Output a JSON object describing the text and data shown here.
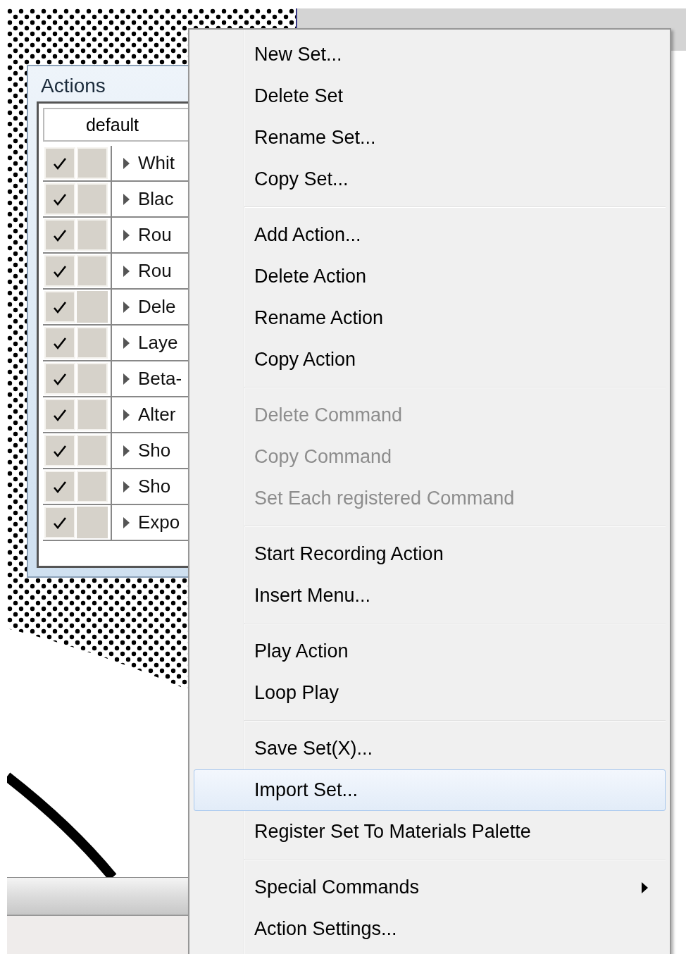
{
  "actions_panel": {
    "title": "Actions",
    "set_name": "default",
    "rows": [
      {
        "name": "Whit",
        "checked": true,
        "dialog_toggle": true
      },
      {
        "name": "Blac",
        "checked": true,
        "dialog_toggle": true
      },
      {
        "name": "Rou",
        "checked": true,
        "dialog_toggle": true
      },
      {
        "name": "Rou",
        "checked": true,
        "dialog_toggle": true
      },
      {
        "name": "Dele",
        "checked": true,
        "dialog_toggle": false
      },
      {
        "name": "Laye",
        "checked": true,
        "dialog_toggle": true
      },
      {
        "name": "Beta-",
        "checked": true,
        "dialog_toggle": true
      },
      {
        "name": "Alter",
        "checked": true,
        "dialog_toggle": true
      },
      {
        "name": "Sho",
        "checked": true,
        "dialog_toggle": true
      },
      {
        "name": "Sho",
        "checked": true,
        "dialog_toggle": true
      },
      {
        "name": "Expo",
        "checked": true,
        "dialog_toggle": false
      }
    ]
  },
  "context_menu": {
    "groups": [
      [
        {
          "label": "New Set...",
          "disabled": false,
          "selected": false,
          "submenu": false
        },
        {
          "label": "Delete Set",
          "disabled": false,
          "selected": false,
          "submenu": false
        },
        {
          "label": "Rename Set...",
          "disabled": false,
          "selected": false,
          "submenu": false
        },
        {
          "label": "Copy Set...",
          "disabled": false,
          "selected": false,
          "submenu": false
        }
      ],
      [
        {
          "label": "Add Action...",
          "disabled": false,
          "selected": false,
          "submenu": false
        },
        {
          "label": "Delete Action",
          "disabled": false,
          "selected": false,
          "submenu": false
        },
        {
          "label": "Rename Action",
          "disabled": false,
          "selected": false,
          "submenu": false
        },
        {
          "label": "Copy Action",
          "disabled": false,
          "selected": false,
          "submenu": false
        }
      ],
      [
        {
          "label": "Delete Command",
          "disabled": true,
          "selected": false,
          "submenu": false
        },
        {
          "label": "Copy Command",
          "disabled": true,
          "selected": false,
          "submenu": false
        },
        {
          "label": "Set Each registered Command",
          "disabled": true,
          "selected": false,
          "submenu": false
        }
      ],
      [
        {
          "label": "Start Recording Action",
          "disabled": false,
          "selected": false,
          "submenu": false
        },
        {
          "label": "Insert Menu...",
          "disabled": false,
          "selected": false,
          "submenu": false
        }
      ],
      [
        {
          "label": "Play Action",
          "disabled": false,
          "selected": false,
          "submenu": false
        },
        {
          "label": "Loop Play",
          "disabled": false,
          "selected": false,
          "submenu": false
        }
      ],
      [
        {
          "label": "Save Set(X)...",
          "disabled": false,
          "selected": false,
          "submenu": false
        },
        {
          "label": "Import Set...",
          "disabled": false,
          "selected": true,
          "submenu": false
        },
        {
          "label": "Register Set To Materials Palette",
          "disabled": false,
          "selected": false,
          "submenu": false
        }
      ],
      [
        {
          "label": "Special Commands",
          "disabled": false,
          "selected": false,
          "submenu": true
        },
        {
          "label": "Action Settings...",
          "disabled": false,
          "selected": false,
          "submenu": false
        }
      ]
    ]
  }
}
